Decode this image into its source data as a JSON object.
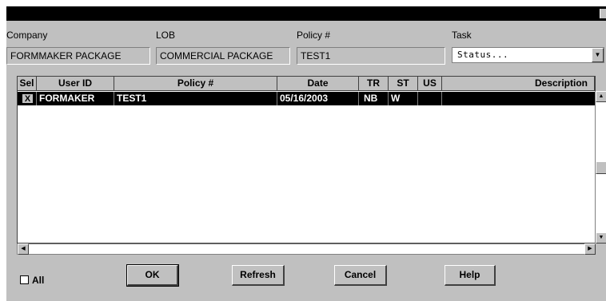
{
  "header": {
    "company_label": "Company",
    "lob_label": "LOB",
    "policy_label": "Policy #",
    "task_label": "Task",
    "company_value": "FORMMAKER PACKAGE",
    "lob_value": "COMMERCIAL PACKAGE",
    "policy_value": "TEST1",
    "task_selected": "Status..."
  },
  "grid": {
    "columns": [
      "Sel",
      "User ID",
      "Policy #",
      "Date",
      "TR",
      "ST",
      "US",
      "Description"
    ],
    "rows": [
      {
        "sel": "X",
        "user_id": "FORMAKER",
        "policy": "TEST1",
        "date": "05/16/2003",
        "tr": "NB",
        "st": "W",
        "us": "",
        "description": ""
      }
    ]
  },
  "footer": {
    "all_label": "All",
    "ok_label": "OK",
    "refresh_label": "Refresh",
    "cancel_label": "Cancel",
    "help_label": "Help"
  },
  "colors": {
    "titlebar": "#000000",
    "dialog_bg": "#c0c0c0",
    "selected_row": "#000000"
  }
}
